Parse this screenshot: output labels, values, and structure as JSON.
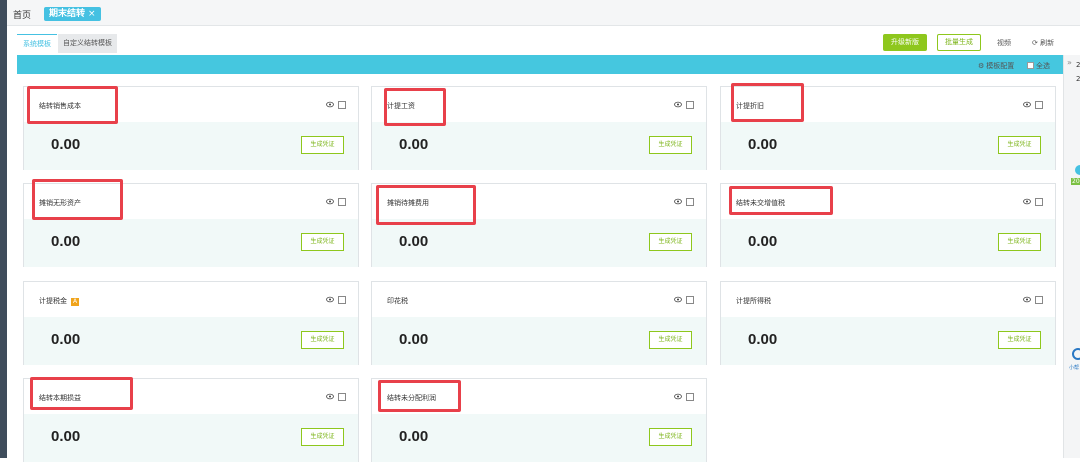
{
  "tabs": {
    "home": "首页",
    "active": "期末结转",
    "close": "×"
  },
  "subtabs": {
    "system": "系统模板",
    "custom": "自定义结转模板"
  },
  "toolbar": {
    "upgrade": "升级新版",
    "generate_all": "批量生成",
    "video": "视频",
    "refresh": "刷新"
  },
  "config": {
    "template_config": "模板配置",
    "select_all": "全选"
  },
  "right_panel": {
    "line1": "2",
    "line2": "2",
    "badge": "2020",
    "small": "小帮"
  },
  "icons": {
    "gear": "gear-icon",
    "refresh": "refresh-icon",
    "eye": "eye-icon",
    "badge_a": "A"
  },
  "colors": {
    "accent": "#45c7df",
    "green": "#8ec71d",
    "highlight": "#e8404a",
    "card_body": "#f1f9f8"
  },
  "cards": [
    {
      "title": "结转销售成本",
      "amount": "0.00",
      "button": "生成凭证",
      "highlighted": true
    },
    {
      "title": "计提工资",
      "amount": "0.00",
      "button": "生成凭证",
      "highlighted": true
    },
    {
      "title": "计提折旧",
      "amount": "0.00",
      "button": "生成凭证",
      "highlighted": true
    },
    {
      "title": "摊销无形资产",
      "amount": "0.00",
      "button": "生成凭证",
      "highlighted": true
    },
    {
      "title": "摊销待摊费用",
      "amount": "0.00",
      "button": "生成凭证",
      "highlighted": true
    },
    {
      "title": "结转未交增值税",
      "amount": "0.00",
      "button": "生成凭证",
      "highlighted": true
    },
    {
      "title": "计提税金",
      "amount": "0.00",
      "button": "生成凭证",
      "highlighted": false,
      "badge": "A"
    },
    {
      "title": "印花税",
      "amount": "0.00",
      "button": "生成凭证",
      "highlighted": false
    },
    {
      "title": "计提所得税",
      "amount": "0.00",
      "button": "生成凭证",
      "highlighted": false
    },
    {
      "title": "结转本期损益",
      "amount": "0.00",
      "button": "生成凭证",
      "highlighted": true
    },
    {
      "title": "结转未分配利润",
      "amount": "0.00",
      "button": "生成凭证",
      "highlighted": true
    }
  ]
}
